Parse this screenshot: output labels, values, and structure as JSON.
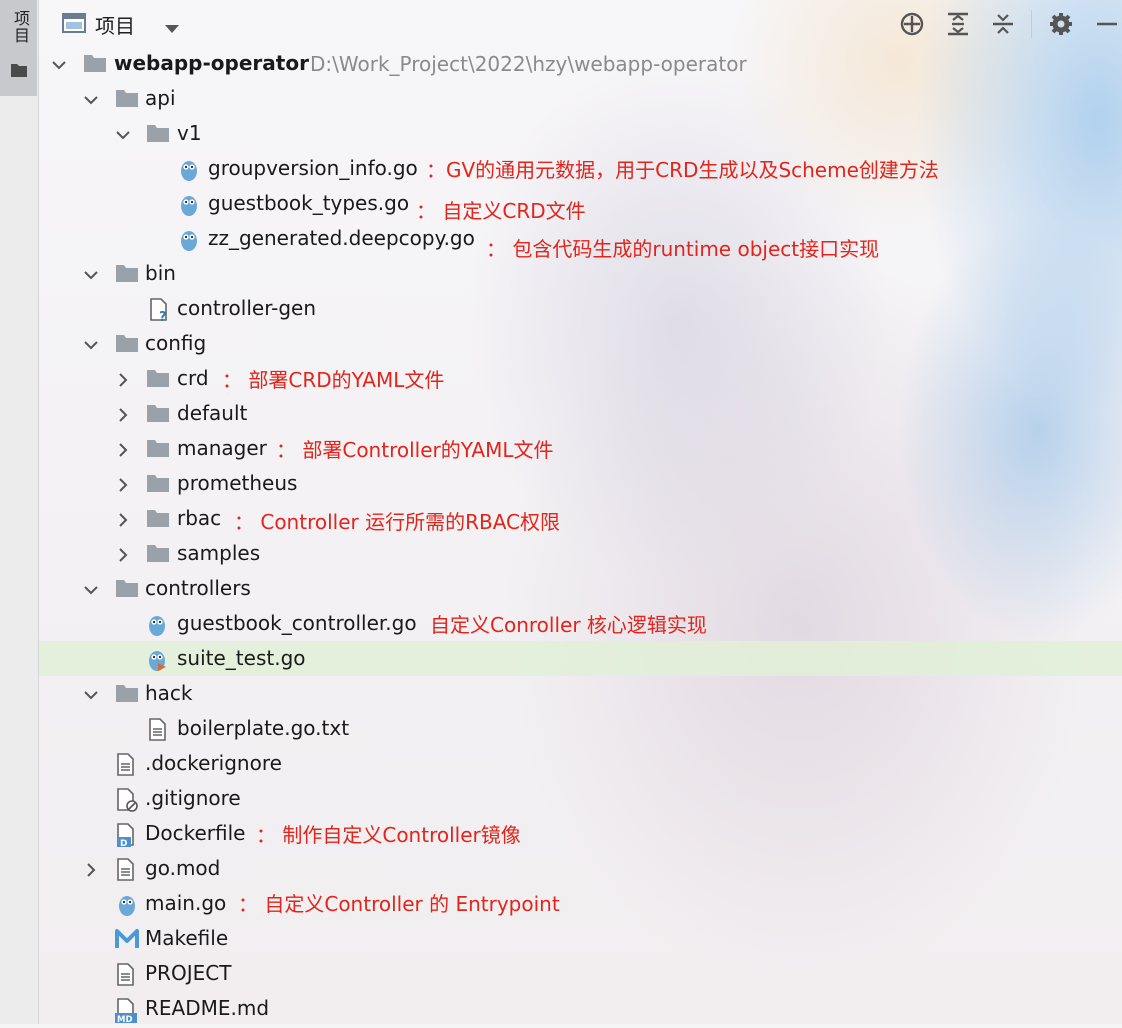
{
  "sidebar": {
    "tab_label": "项目"
  },
  "toolbar": {
    "title": "项目"
  },
  "tree": {
    "root": {
      "name": "webapp-operator",
      "path": "D:\\Work_Project\\2022\\hzy\\webapp-operator"
    },
    "items": [
      {
        "label": "api"
      },
      {
        "label": "v1"
      },
      {
        "label": "groupversion_info.go",
        "note": "：GV的通用元数据，用于CRD生成以及Scheme创建方法"
      },
      {
        "label": "guestbook_types.go",
        "note": "： 自定义CRD文件"
      },
      {
        "label": "zz_generated.deepcopy.go",
        "note": "： 包含代码生成的runtime object接口实现"
      },
      {
        "label": "bin"
      },
      {
        "label": "controller-gen"
      },
      {
        "label": "config"
      },
      {
        "label": "crd",
        "note": "： 部署CRD的YAML文件"
      },
      {
        "label": "default"
      },
      {
        "label": "manager",
        "note": "： 部署Controller的YAML文件"
      },
      {
        "label": "prometheus"
      },
      {
        "label": "rbac",
        "note": "： Controller 运行所需的RBAC权限"
      },
      {
        "label": "samples"
      },
      {
        "label": "controllers"
      },
      {
        "label": "guestbook_controller.go",
        "note": "自定义Conroller 核心逻辑实现"
      },
      {
        "label": "suite_test.go"
      },
      {
        "label": "hack"
      },
      {
        "label": "boilerplate.go.txt"
      },
      {
        "label": ".dockerignore"
      },
      {
        "label": ".gitignore"
      },
      {
        "label": "Dockerfile",
        "note": "： 制作自定义Controller镜像"
      },
      {
        "label": "go.mod"
      },
      {
        "label": "main.go",
        "note": "： 自定义Controller 的 Entrypoint"
      },
      {
        "label": "Makefile"
      },
      {
        "label": "PROJECT"
      },
      {
        "label": "README.md"
      }
    ]
  },
  "colors": {
    "annotation": "#e1251b",
    "selected_row": "#e1f0d7",
    "folder": "#9aa1a8"
  }
}
